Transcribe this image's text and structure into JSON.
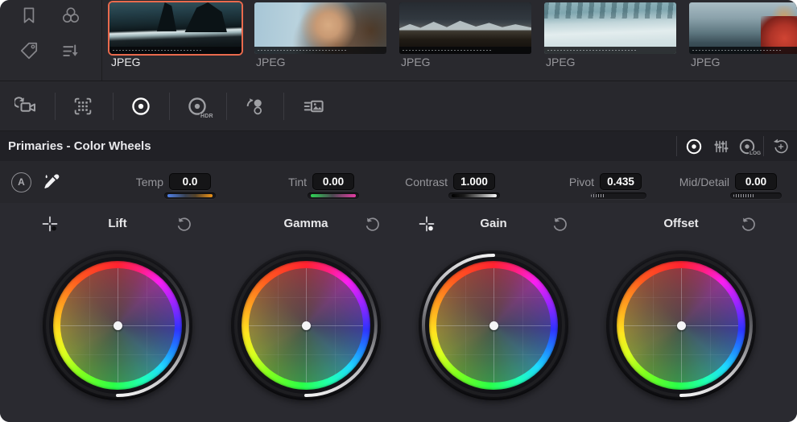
{
  "app": {
    "accent": "#ea6a4d",
    "bg": "#28282d"
  },
  "clips": {
    "items": [
      {
        "label": "JPEG",
        "selected": true
      },
      {
        "label": "JPEG",
        "selected": false
      },
      {
        "label": "JPEG",
        "selected": false
      },
      {
        "label": "JPEG",
        "selected": false
      },
      {
        "label": "JPEG",
        "selected": false
      }
    ]
  },
  "library": {
    "icons": [
      "bookmark-icon",
      "color-group-icon",
      "tag-icon",
      "sort-list-icon"
    ]
  },
  "toolbar": {
    "tools": [
      {
        "name": "camera-raw-icon",
        "active": false
      },
      {
        "name": "frame-grid-icon",
        "active": false
      },
      {
        "name": "color-wheels-icon",
        "active": true
      },
      {
        "name": "hdr-wheels-icon",
        "active": false,
        "label": "HDR"
      },
      {
        "name": "color-match-icon",
        "active": false
      },
      {
        "name": "stills-icon",
        "active": false
      }
    ]
  },
  "panel": {
    "title": "Primaries - Color Wheels",
    "mode_icons": [
      {
        "name": "wheels-mode-icon",
        "active": true
      },
      {
        "name": "bars-mode-icon",
        "active": false
      },
      {
        "name": "log-mode-icon",
        "active": false,
        "label": "LOG"
      }
    ],
    "reset_icon": "reset-panel-icon"
  },
  "adjustments": {
    "auto_label": "A",
    "items": [
      {
        "id": "temp",
        "label": "Temp",
        "value": "0.0",
        "slider": "blue-orange"
      },
      {
        "id": "tint",
        "label": "Tint",
        "value": "0.00",
        "slider": "green-magenta"
      },
      {
        "id": "contrast",
        "label": "Contrast",
        "value": "1.000",
        "slider": "black-white"
      },
      {
        "id": "pivot",
        "label": "Pivot",
        "value": "0.435",
        "slider": "center-ticks"
      },
      {
        "id": "mid_detail",
        "label": "Mid/Detail",
        "value": "0.00",
        "slider": "right-ticks"
      }
    ]
  },
  "wheels": [
    {
      "label": "Lift",
      "picker": true,
      "picker_dot": "black",
      "luma_arc": "bottom-right"
    },
    {
      "label": "Gamma",
      "picker": false,
      "luma_arc": "bottom-right"
    },
    {
      "label": "Gain",
      "picker": true,
      "picker_dot": "white",
      "luma_arc": "top-left"
    },
    {
      "label": "Offset",
      "picker": false,
      "luma_arc": "bottom-right"
    }
  ]
}
